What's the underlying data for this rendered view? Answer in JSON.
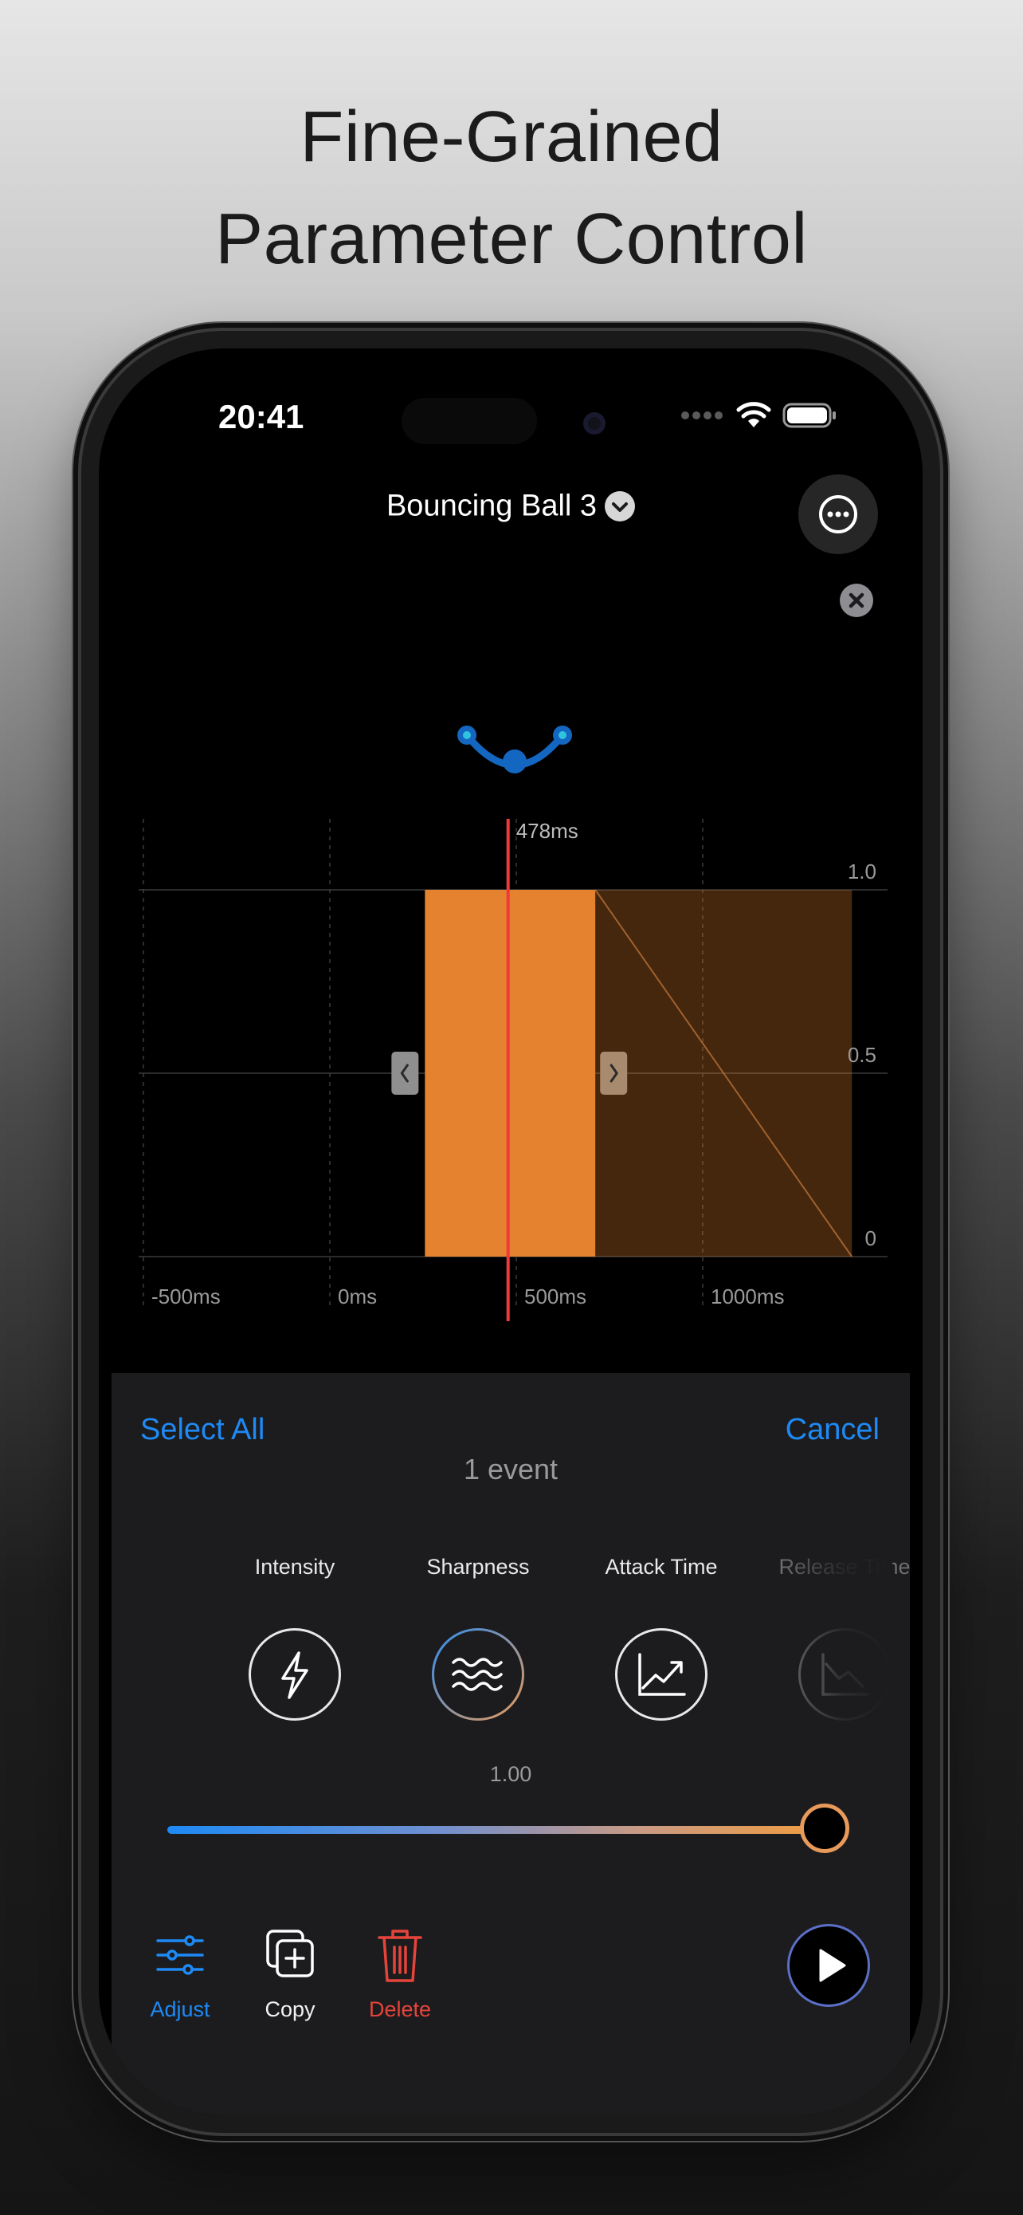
{
  "headline": {
    "line1": "Fine-Grained",
    "line2": "Parameter Control"
  },
  "status": {
    "time": "20:41"
  },
  "editor": {
    "title": "Bouncing Ball 3"
  },
  "timeline": {
    "playhead_label": "478ms",
    "y_labels": [
      "1.0",
      "0.5",
      "0"
    ],
    "x_labels": [
      "-500ms",
      "0ms",
      "500ms",
      "1000ms"
    ]
  },
  "chart_data": {
    "type": "area",
    "playhead_ms": 478,
    "xlim": [
      -500,
      1300
    ],
    "ylim": [
      0,
      1
    ],
    "x_ticks": [
      "-500ms",
      "0ms",
      "500ms",
      "1000ms"
    ],
    "y_ticks": [
      "1.0",
      "0.5",
      "0"
    ],
    "event": {
      "start_ms": 255,
      "attack_end_ms": 712,
      "release_end_ms": 1400,
      "intensity": 1.0
    }
  },
  "panel": {
    "select_all": "Select All",
    "cancel": "Cancel",
    "event_count": "1 event",
    "params": [
      {
        "label": "Intensity",
        "icon": "lightning-icon"
      },
      {
        "label": "Sharpness",
        "icon": "waves-icon"
      },
      {
        "label": "Attack Time",
        "icon": "rising-chart-icon"
      },
      {
        "label": "Release Time",
        "icon": "falling-chart-icon"
      }
    ],
    "selected_param": "Sharpness",
    "value": "1.00",
    "slider_value": 1.0,
    "tools": {
      "adjust": "Adjust",
      "copy": "Copy",
      "delete": "Delete"
    }
  },
  "colors": {
    "accent_blue": "#1e8af5",
    "orange": "#e5822f",
    "playhead_red": "#f2383a",
    "delete_red": "#e5443b"
  }
}
